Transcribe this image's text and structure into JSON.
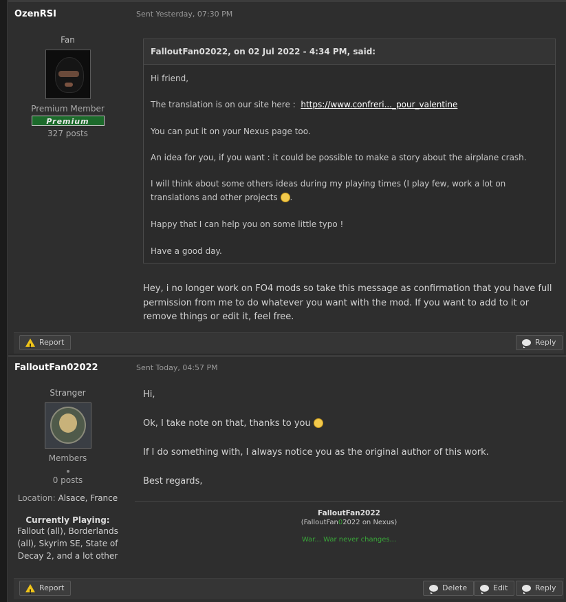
{
  "post1": {
    "username": "OzenRSI",
    "sent": "Sent Yesterday, 07:30 PM",
    "rank_title": "Fan",
    "group": "Premium Member",
    "badge": "Premium",
    "posts": "327 posts",
    "quote": {
      "header": "FalloutFan02022, on 02 Jul 2022 - 4:34 PM, said:",
      "greeting": "Hi friend,",
      "translation_text": "The translation is on our site here :",
      "translation_link": "https://www.confreri..._pour_valentine",
      "nexus": "You can put it on your Nexus page too.",
      "idea": "An idea for you, if you want : it could be possible to make a story about the airplane crash.",
      "think": "I will think about some others ideas during my playing times (I play few, work a lot on translations and other projects",
      "think_end": ".",
      "happy": "Happy that I can help you on some little typo !",
      "goodday": "Have a good day."
    },
    "reply_text": "Hey, i no longer work on FO4 mods so take this message as confirmation that you have full permission from me to do whatever you want with the mod. If you want to add to it or remove things  or edit it, feel free.",
    "report_label": "Report",
    "reply_label": "Reply"
  },
  "post2": {
    "username": "FalloutFan02022",
    "sent": "Sent Today, 04:57 PM",
    "rank_title": "Stranger",
    "group": "Members",
    "posts": "0 posts",
    "location_label": "Location:",
    "location_value": "Alsace, France",
    "playing_label": "Currently Playing:",
    "playing_value": "Fallout (all), Borderlands (all), Skyrim SE, State of Decay 2, and a lot other",
    "line1": "Hi,",
    "line2": "Ok, I take note on that, thanks to you",
    "line3": "If I do something with, I always notice you as the original author of this work.",
    "line4": "Best regards,",
    "sig_name": "FalloutFan2022",
    "sig_sub_a": "(FalloutFan",
    "sig_sub_b": "0",
    "sig_sub_c": "2022 on Nexus)",
    "sig_motto": "War... War never changes...",
    "report_label": "Report",
    "delete_label": "Delete",
    "edit_label": "Edit",
    "reply_label": "Reply"
  },
  "icons": {
    "report": "warning-icon",
    "reply": "speech-bubble-icon",
    "delete": "speech-bubble-icon",
    "edit": "speech-bubble-icon",
    "smiley": "wink-smiley-icon"
  },
  "colors": {
    "background": "#2a2a2a",
    "panel": "#2e2e2e",
    "premium_badge": "#1c6a2b",
    "warning": "#f0c419",
    "signature_green": "#39a639"
  }
}
